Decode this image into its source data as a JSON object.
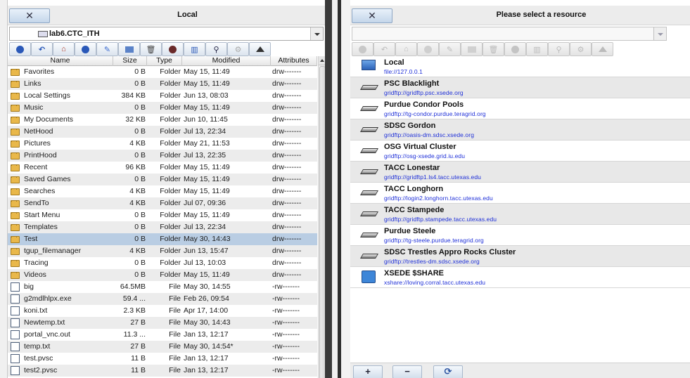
{
  "local_pane": {
    "close_label": "✕",
    "title": "Local",
    "path": "lab6.CTC_ITH",
    "columns": [
      "Name",
      "Size",
      "Type",
      "Modified",
      "Attributes"
    ],
    "rows": [
      {
        "name": "Favorites",
        "size": "0 B",
        "type": "Folder",
        "modified": "May 15, 11:49",
        "attr": "drw-------",
        "kind": "folder"
      },
      {
        "name": "Links",
        "size": "0 B",
        "type": "Folder",
        "modified": "May 15, 11:49",
        "attr": "drw-------",
        "kind": "folder"
      },
      {
        "name": "Local Settings",
        "size": "384 KB",
        "type": "Folder",
        "modified": "Jun 13, 08:03",
        "attr": "drw-------",
        "kind": "folder"
      },
      {
        "name": "Music",
        "size": "0 B",
        "type": "Folder",
        "modified": "May 15, 11:49",
        "attr": "drw-------",
        "kind": "folder"
      },
      {
        "name": "My Documents",
        "size": "32 KB",
        "type": "Folder",
        "modified": "Jun 10, 11:45",
        "attr": "drw-------",
        "kind": "folder"
      },
      {
        "name": "NetHood",
        "size": "0 B",
        "type": "Folder",
        "modified": "Jul 13, 22:34",
        "attr": "drw-------",
        "kind": "folder"
      },
      {
        "name": "Pictures",
        "size": "4 KB",
        "type": "Folder",
        "modified": "May 21, 11:53",
        "attr": "drw-------",
        "kind": "folder"
      },
      {
        "name": "PrintHood",
        "size": "0 B",
        "type": "Folder",
        "modified": "Jul 13, 22:35",
        "attr": "drw-------",
        "kind": "folder"
      },
      {
        "name": "Recent",
        "size": "96 KB",
        "type": "Folder",
        "modified": "May 15, 11:49",
        "attr": "drw-------",
        "kind": "folder"
      },
      {
        "name": "Saved Games",
        "size": "0 B",
        "type": "Folder",
        "modified": "May 15, 11:49",
        "attr": "drw-------",
        "kind": "folder"
      },
      {
        "name": "Searches",
        "size": "4 KB",
        "type": "Folder",
        "modified": "May 15, 11:49",
        "attr": "drw-------",
        "kind": "folder"
      },
      {
        "name": "SendTo",
        "size": "4 KB",
        "type": "Folder",
        "modified": "Jul 07, 09:36",
        "attr": "drw-------",
        "kind": "folder"
      },
      {
        "name": "Start Menu",
        "size": "0 B",
        "type": "Folder",
        "modified": "May 15, 11:49",
        "attr": "drw-------",
        "kind": "folder"
      },
      {
        "name": "Templates",
        "size": "0 B",
        "type": "Folder",
        "modified": "Jul 13, 22:34",
        "attr": "drw-------",
        "kind": "folder"
      },
      {
        "name": "Test",
        "size": "0 B",
        "type": "Folder",
        "modified": "May 30, 14:43",
        "attr": "drw-------",
        "kind": "folder",
        "selected": true
      },
      {
        "name": "tgup_filemanager",
        "size": "4 KB",
        "type": "Folder",
        "modified": "Jun 13, 15:47",
        "attr": "drw-------",
        "kind": "folder"
      },
      {
        "name": "Tracing",
        "size": "0 B",
        "type": "Folder",
        "modified": "Jul 13, 10:03",
        "attr": "drw-------",
        "kind": "folder"
      },
      {
        "name": "Videos",
        "size": "0 B",
        "type": "Folder",
        "modified": "May 15, 11:49",
        "attr": "drw-------",
        "kind": "folder"
      },
      {
        "name": "big",
        "size": "64.5MB",
        "type": "File",
        "modified": "May 30, 14:55",
        "attr": "-rw-------",
        "kind": "file"
      },
      {
        "name": "g2mdlhlpx.exe",
        "size": "59.4 ...",
        "type": "File",
        "modified": "Feb 26, 09:54",
        "attr": "-rw-------",
        "kind": "file"
      },
      {
        "name": "koni.txt",
        "size": "2.3 KB",
        "type": "File",
        "modified": "Apr 17, 14:00",
        "attr": "-rw-------",
        "kind": "file"
      },
      {
        "name": "Newtemp.txt",
        "size": "27 B",
        "type": "File",
        "modified": "May 30, 14:43",
        "attr": "-rw-------",
        "kind": "file"
      },
      {
        "name": "portal_vnc.out",
        "size": "11.3 ...",
        "type": "File",
        "modified": "Jan 13, 12:17",
        "attr": "-rw-------",
        "kind": "file"
      },
      {
        "name": "temp.txt",
        "size": "27 B",
        "type": "File",
        "modified": "May 30, 14:54*",
        "attr": "-rw-------",
        "kind": "file"
      },
      {
        "name": "test.pvsc",
        "size": "11 B",
        "type": "File",
        "modified": "Jan 13, 12:17",
        "attr": "-rw-------",
        "kind": "file"
      },
      {
        "name": "test2.pvsc",
        "size": "11 B",
        "type": "File",
        "modified": "Jan 13, 12:17",
        "attr": "-rw-------",
        "kind": "file"
      }
    ]
  },
  "remote_pane": {
    "close_label": "✕",
    "title": "Please select a resource",
    "path": "",
    "resources": [
      {
        "name": "Local",
        "url": "file://127.0.0.1",
        "icon": "local-computer-icon"
      },
      {
        "name": "PSC Blacklight",
        "url": "gridftp://gridftp.psc.xsede.org",
        "icon": "server-icon"
      },
      {
        "name": "Purdue Condor Pools",
        "url": "gridftp://tg-condor.purdue.teragrid.org",
        "icon": "server-icon"
      },
      {
        "name": "SDSC Gordon",
        "url": "gridftp://oasis-dm.sdsc.xsede.org",
        "icon": "server-icon"
      },
      {
        "name": "OSG Virtual Cluster",
        "url": "gridftp://osg-xsede.grid.iu.edu",
        "icon": "server-icon"
      },
      {
        "name": "TACC Lonestar",
        "url": "gridftp://gridftp1.ls4.tacc.utexas.edu",
        "icon": "server-icon"
      },
      {
        "name": "TACC Longhorn",
        "url": "gridftp://login2.longhorn.tacc.utexas.edu",
        "icon": "server-icon"
      },
      {
        "name": "TACC Stampede",
        "url": "gridftp://gridftp.stampede.tacc.utexas.edu",
        "icon": "server-icon"
      },
      {
        "name": "Purdue Steele",
        "url": "gridftp://tg-steele.purdue.teragrid.org",
        "icon": "server-icon"
      },
      {
        "name": "SDSC Trestles Appro Rocks Cluster",
        "url": "gridftp://trestles-dm.sdsc.xsede.org",
        "icon": "server-icon"
      },
      {
        "name": "XSEDE $SHARE",
        "url": "xshare://loving.corral.tacc.utexas.edu",
        "icon": "cloud-share-icon"
      }
    ],
    "add_label": "+",
    "remove_label": "−",
    "refresh_label": "⟳"
  },
  "colors": {
    "selection": "#b9cde3",
    "link_blue": "#1e2fd8",
    "folder": "#e9b84a"
  }
}
